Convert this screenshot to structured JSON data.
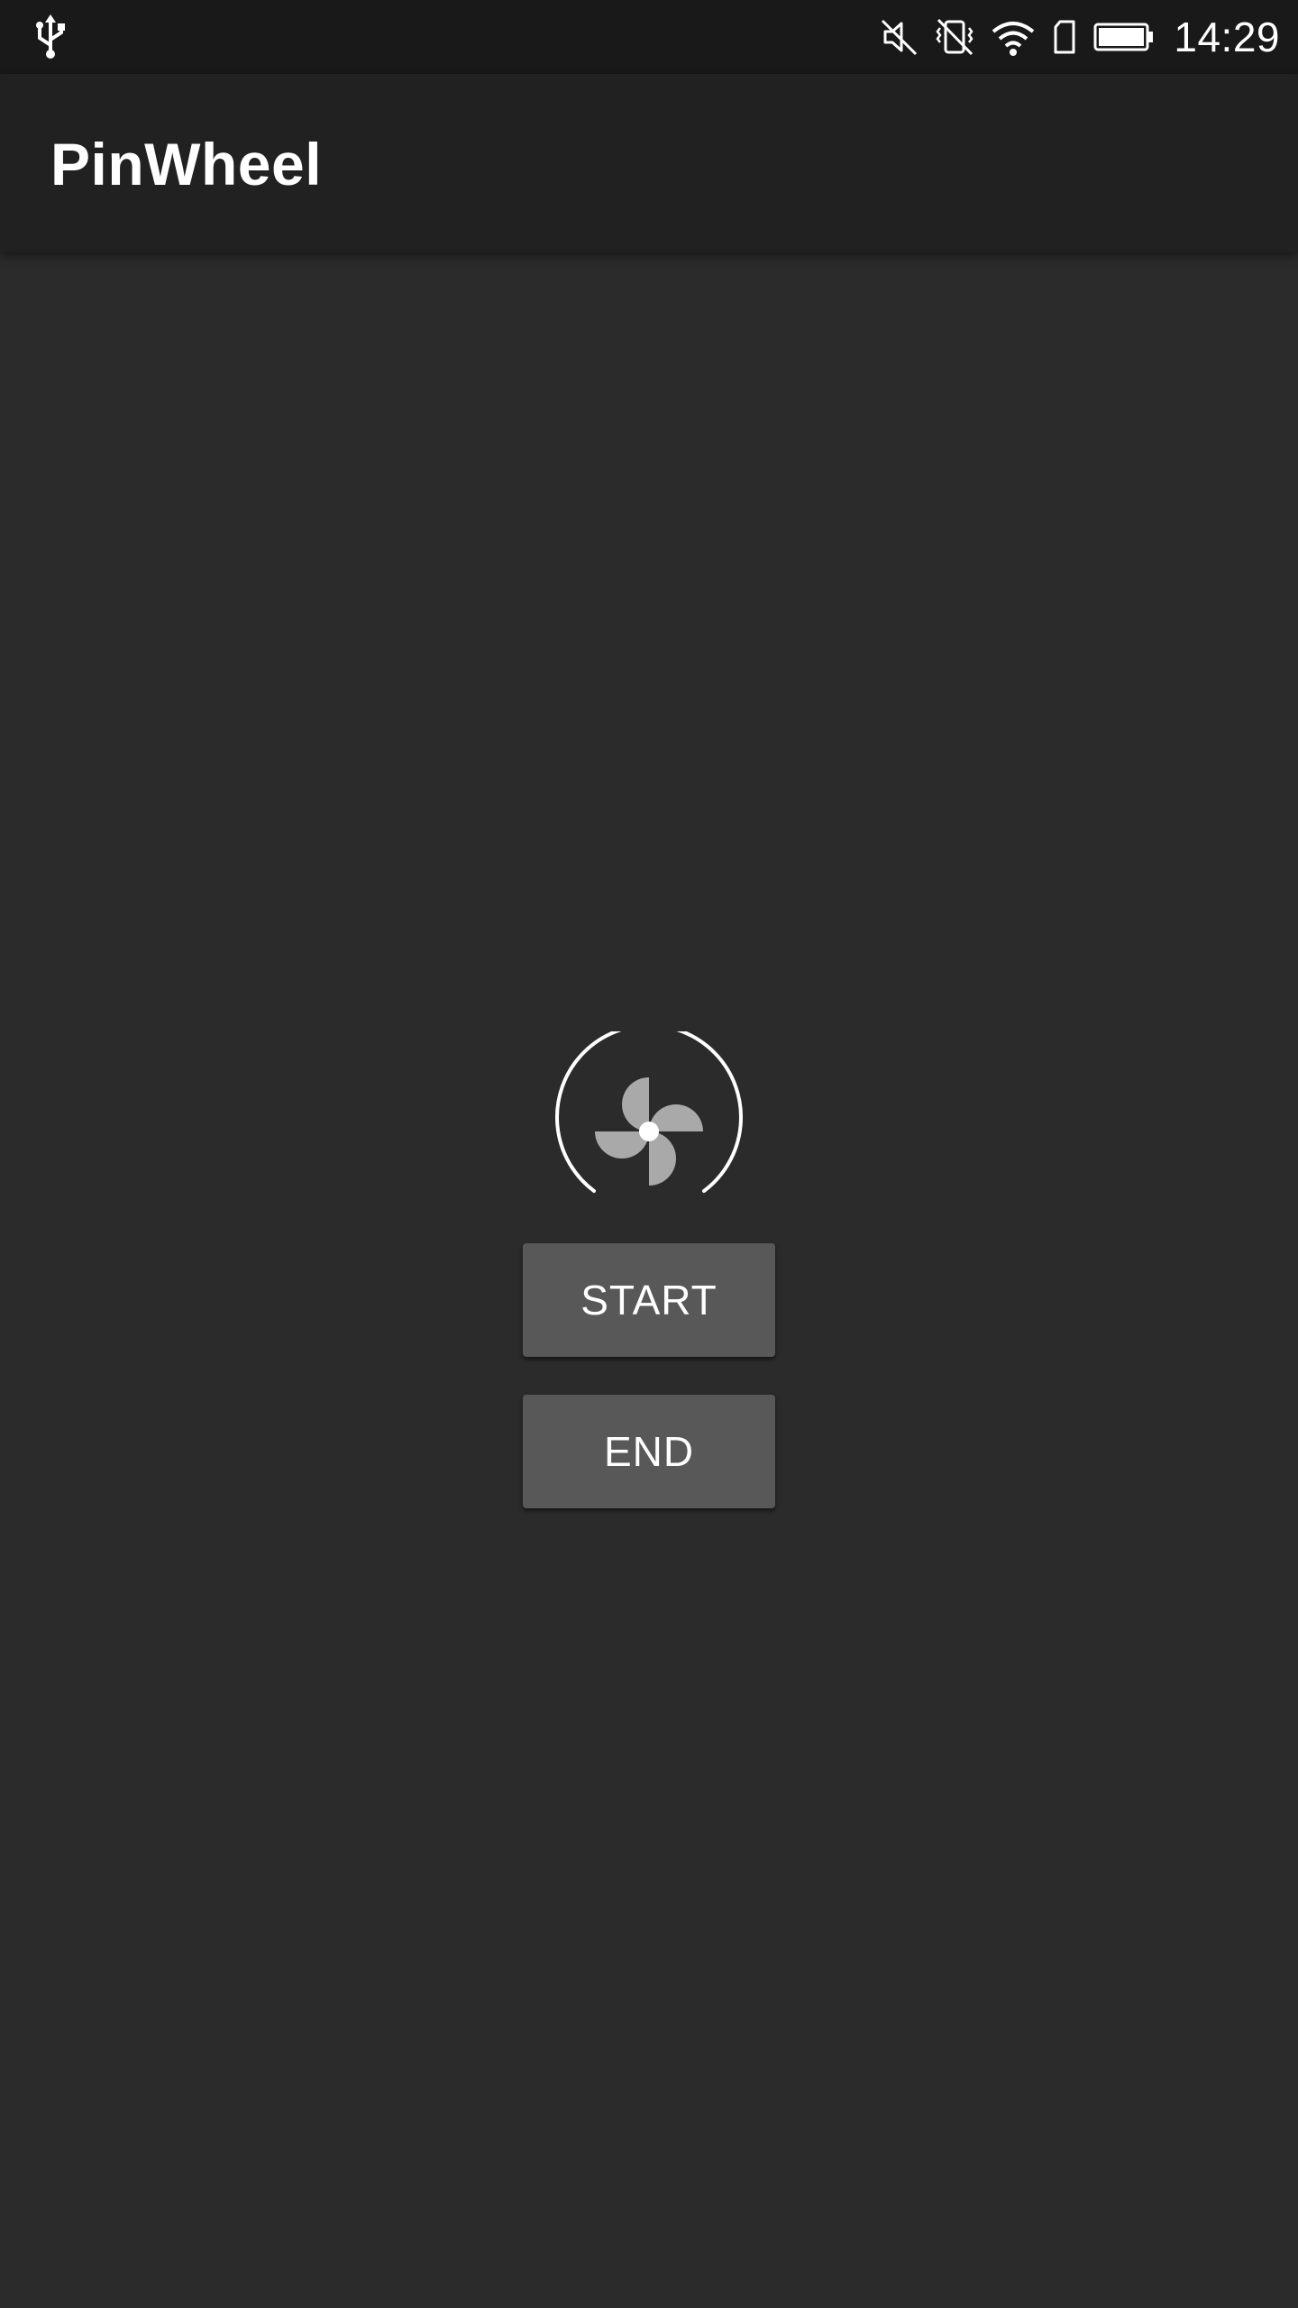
{
  "status_bar": {
    "time": "14:29",
    "icons": [
      "usb-icon",
      "mute-icon",
      "vibrate-off-icon",
      "wifi-icon",
      "sim-card-icon",
      "battery-icon"
    ]
  },
  "app_bar": {
    "title": "PinWheel"
  },
  "main": {
    "pinwheel": {
      "icon": "pinwheel-icon"
    },
    "start_button": {
      "label": "START"
    },
    "end_button": {
      "label": "END"
    }
  },
  "colors": {
    "background": "#2b2b2b",
    "app_bar": "#212121",
    "status_bar": "#191919",
    "button": "#585858",
    "text": "#ffffff",
    "pinwheel_blade": "#a9a9a9"
  }
}
